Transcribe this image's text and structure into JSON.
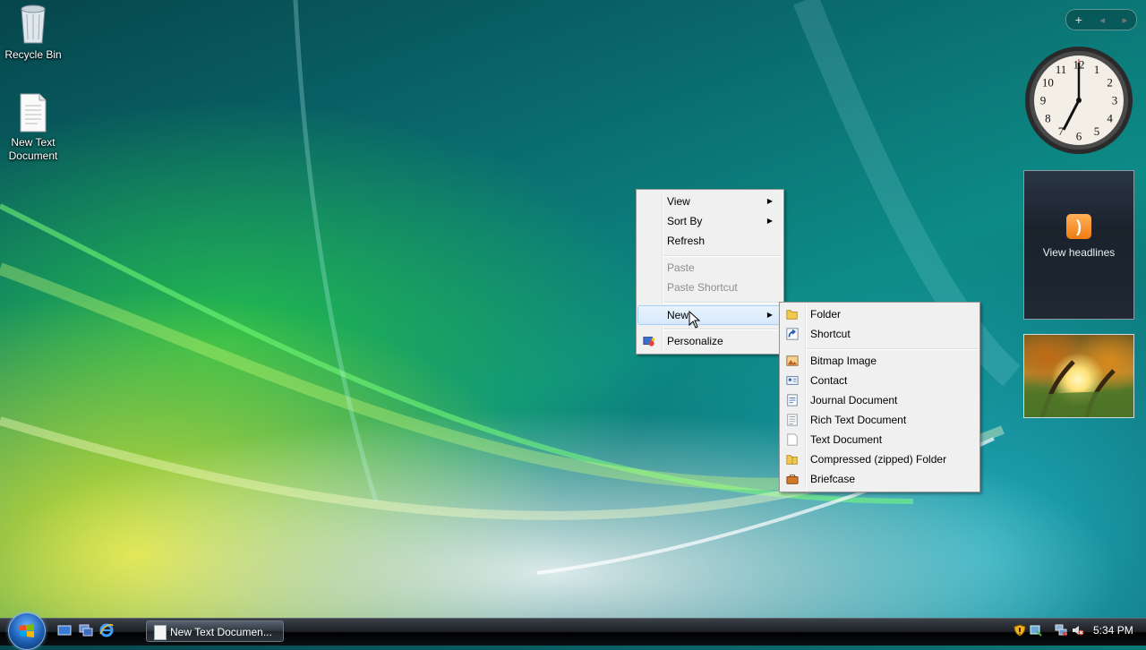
{
  "desktop": {
    "icons": [
      {
        "label": "Recycle Bin",
        "icon": "recycle-bin-icon"
      },
      {
        "label": "New Text Document",
        "icon": "text-document-icon"
      }
    ]
  },
  "sidebar": {
    "top_controls": {
      "add": "+",
      "prev": "◂",
      "next": "▸"
    },
    "clock": {
      "numerals": [
        "12",
        "1",
        "2",
        "3",
        "4",
        "5",
        "6",
        "7",
        "8",
        "9",
        "10",
        "11"
      ],
      "time": "5:34"
    },
    "feed_gadget": {
      "label": "View headlines",
      "icon": "rss-icon"
    },
    "slideshow_gadget": {
      "icon": "autumn-photo"
    }
  },
  "context_menu": {
    "items": [
      {
        "label": "View",
        "submenu": true,
        "enabled": true
      },
      {
        "label": "Sort By",
        "submenu": true,
        "enabled": true
      },
      {
        "label": "Refresh",
        "submenu": false,
        "enabled": true
      },
      {
        "label": "Paste",
        "submenu": false,
        "enabled": false
      },
      {
        "label": "Paste Shortcut",
        "submenu": false,
        "enabled": false
      },
      {
        "label": "New",
        "submenu": true,
        "enabled": true,
        "highlighted": true
      },
      {
        "label": "Personalize",
        "submenu": false,
        "enabled": true,
        "icon": "personalize-icon"
      }
    ]
  },
  "new_submenu": {
    "items": [
      {
        "label": "Folder",
        "icon": "folder-icon"
      },
      {
        "label": "Shortcut",
        "icon": "shortcut-icon"
      },
      {
        "label": "Bitmap Image",
        "icon": "bitmap-icon"
      },
      {
        "label": "Contact",
        "icon": "contact-icon"
      },
      {
        "label": "Journal Document",
        "icon": "journal-icon"
      },
      {
        "label": "Rich Text Document",
        "icon": "rich-text-icon"
      },
      {
        "label": "Text Document",
        "icon": "text-document-icon"
      },
      {
        "label": "Compressed (zipped) Folder",
        "icon": "zip-folder-icon"
      },
      {
        "label": "Briefcase",
        "icon": "briefcase-icon"
      }
    ]
  },
  "taskbar": {
    "task_button": "New Text Documen...",
    "clock": "5:34 PM"
  },
  "colors": {
    "menu_bg": "#f0f0f0",
    "menu_highlight": "#d6e9fb",
    "taskbar": "#1a1e23"
  }
}
